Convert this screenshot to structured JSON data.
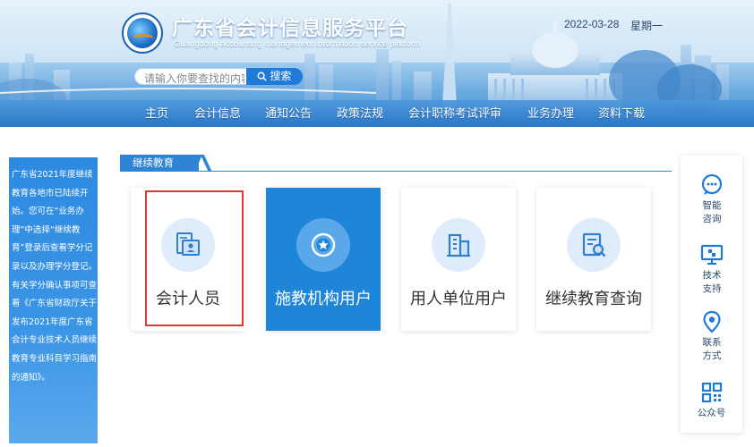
{
  "header": {
    "site_title": "广东省会计信息服务平台",
    "site_subtitle": "Guangdong accounting management information service platform",
    "date": "2022-03-28",
    "weekday": "星期一"
  },
  "search": {
    "placeholder": "请输入你要查找的内容",
    "button_label": "搜索"
  },
  "nav": {
    "items": [
      "主页",
      "会计信息",
      "通知公告",
      "政策法规",
      "会计职称考试评审",
      "业务办理",
      "资料下载"
    ]
  },
  "notice": {
    "text": "广东省2021年度继续教育各地市已陆续开始。您可在“业务办理”中选择“继续教育”登录后查看学分记录以及办理学分登记。有关学分确认事项可查看《广东省财政厅关于发布2021年度广东省会计专业技术人员继续教育专业科目学习指南的通知》。"
  },
  "section": {
    "title": "继续教育"
  },
  "cards": [
    {
      "label": "会计人员",
      "icon": "id-card-icon",
      "active": false,
      "highlighted": true
    },
    {
      "label": "施教机构用户",
      "icon": "badge-star-icon",
      "active": true,
      "highlighted": false
    },
    {
      "label": "用人单位用户",
      "icon": "building-icon",
      "active": false,
      "highlighted": false
    },
    {
      "label": "继续教育查询",
      "icon": "document-search-icon",
      "active": false,
      "highlighted": false
    }
  ],
  "sidebar": {
    "items": [
      {
        "label": "智能咨询",
        "icon": "chat-bubble-icon"
      },
      {
        "label": "技术支持",
        "icon": "monitor-icon"
      },
      {
        "label": "联系方式",
        "icon": "location-pin-icon"
      },
      {
        "label": "公众号",
        "icon": "qr-code-icon"
      }
    ]
  },
  "colors": {
    "primary": "#1e85d9",
    "highlight": "#e23737",
    "card_icon_bg": "#dfecfb"
  }
}
